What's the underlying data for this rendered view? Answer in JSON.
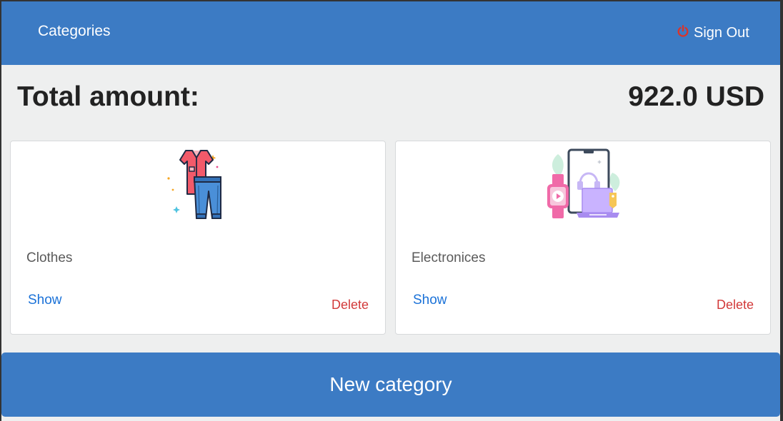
{
  "header": {
    "title": "Categories",
    "signout_label": "Sign Out",
    "signout_icon": "power-icon"
  },
  "summary": {
    "label": "Total amount:",
    "value": "922.0 USD"
  },
  "categories": [
    {
      "name": "Clothes",
      "image": "clothes-illustration",
      "show_label": "Show",
      "delete_label": "Delete"
    },
    {
      "name": "Electronices",
      "image": "electronics-illustration",
      "show_label": "Show",
      "delete_label": "Delete"
    }
  ],
  "new_category_label": "New category",
  "colors": {
    "primary": "#3c7bc4",
    "background": "#eeefef",
    "link": "#1b72d8",
    "danger": "#d23a3a",
    "power_icon": "#d9342b"
  }
}
